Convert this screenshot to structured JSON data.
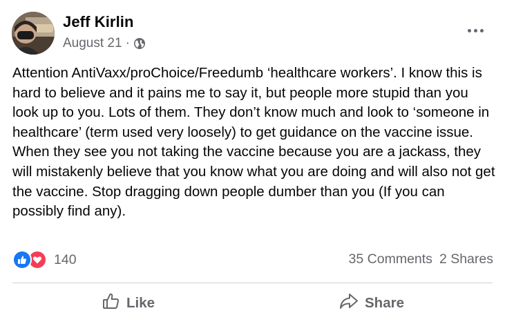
{
  "post": {
    "author": "Jeff Kirlin",
    "date": "August 21",
    "separator": "·",
    "privacy_icon": "globe-icon",
    "body": "Attention AntiVaxx/proChoice/Freedumb ‘healthcare workers’. I know this is hard to believe and it pains me to say it, but people more stupid than you look up to you. Lots of them. They don’t know much and look to ‘someone in healthcare’ (term used very loosely) to get guidance on the vaccine issue. When they see you not taking the vaccine because you are a jackass, they will mistakenly believe that you know what you are doing and will also not get the vaccine. Stop dragging down people dumber than you (If you can possibly find any).",
    "reactions": {
      "icons": [
        "like-icon",
        "love-icon"
      ],
      "count": "140"
    },
    "comments": "35 Comments",
    "shares": "2 Shares",
    "actions": {
      "like": "Like",
      "share": "Share"
    }
  },
  "colors": {
    "text": "#050505",
    "secondary": "#65676b",
    "like_blue": "#1877f2",
    "love_red": "#f33e58",
    "divider": "#ced0d4"
  }
}
